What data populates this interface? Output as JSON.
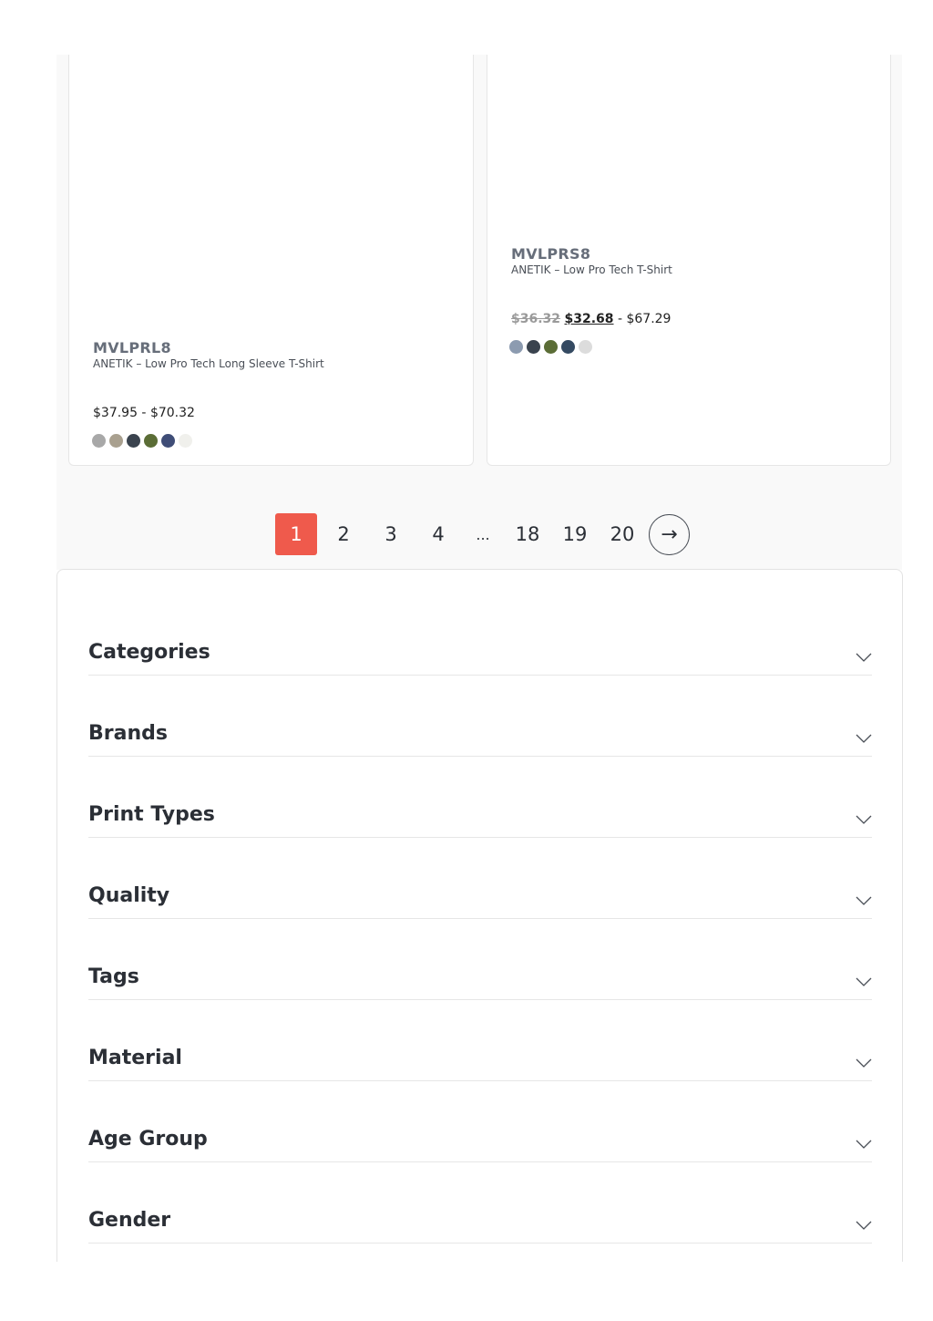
{
  "products": [
    {
      "sku": "MVLPRL8",
      "name": "ANETIK – Low Pro Tech Long Sleeve T-Shirt",
      "price_range": "$37.95 - $70.32",
      "swatches": [
        "#a8a8a8",
        "#a9a08f",
        "#3a434e",
        "#5b6d36",
        "#3f4d77",
        "#f0f0ec"
      ]
    },
    {
      "sku": "MVLPRS8",
      "name": "ANETIK – Low Pro Tech T-Shirt",
      "price_old": "$36.32",
      "price_sale": "$32.68",
      "price_max": "- $67.29",
      "swatches": [
        "#8c9bb0",
        "#3a434e",
        "#5b6d36",
        "#344a62",
        "#dcdcdc"
      ]
    }
  ],
  "pagination": {
    "pages": [
      "1",
      "2",
      "3",
      "4",
      "...",
      "18",
      "19",
      "20"
    ],
    "active": "1",
    "next_icon": "→"
  },
  "filters": [
    "Categories",
    "Brands",
    "Print Types",
    "Quality",
    "Tags",
    "Material",
    "Age Group",
    "Gender"
  ],
  "colors": {
    "accent": "#ef5a4c",
    "text": "#2b2f36"
  }
}
